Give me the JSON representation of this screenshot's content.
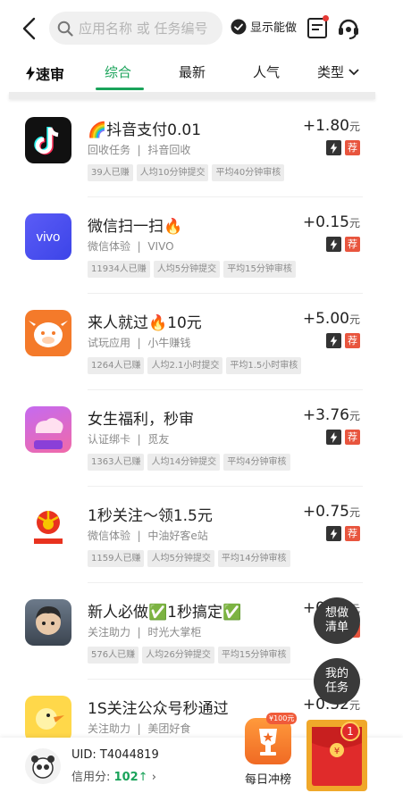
{
  "header": {
    "search_placeholder": "应用名称 或 任务编号",
    "show_done_label": "显示能做"
  },
  "tabs": {
    "brand": "速审",
    "items": [
      "综合",
      "最新",
      "人气",
      "类型"
    ],
    "active": "综合"
  },
  "price_unit": "元",
  "tasks": [
    {
      "title": "🌈抖音支付0.01",
      "category": "回收任务",
      "app": "抖音回收",
      "tags": [
        "39人已赚",
        "人均10分钟提交",
        "平均40分钟审核"
      ],
      "price": "+1.80",
      "icon": "douyin-icon"
    },
    {
      "title": "微信扫一扫🔥",
      "category": "微信体验",
      "app": "VIVO",
      "tags": [
        "11934人已赚",
        "人均5分钟提交",
        "平均15分钟审核"
      ],
      "price": "+0.15",
      "icon": "vivo-icon"
    },
    {
      "title": "来人就过🔥10元",
      "category": "试玩应用",
      "app": "小牛赚钱",
      "tags": [
        "1264人已赚",
        "人均2.1小时提交",
        "平均1.5小时审核"
      ],
      "price": "+5.00",
      "icon": "cow-icon"
    },
    {
      "title": "女生福利，秒审",
      "category": "认证绑卡",
      "app": "觅友",
      "tags": [
        "1363人已赚",
        "人均14分钟提交",
        "平均4分钟审核"
      ],
      "price": "+3.76",
      "icon": "miyou-icon"
    },
    {
      "title": "1秒关注～领1.5元",
      "category": "微信体验",
      "app": "中油好客e站",
      "tags": [
        "1159人已赚",
        "人均5分钟提交",
        "平均14分钟审核"
      ],
      "price": "+0.75",
      "icon": "petrochina-icon"
    },
    {
      "title": "新人必做✅1秒搞定✅",
      "category": "关注助力",
      "app": "时光大掌柜",
      "tags": [
        "576人已赚",
        "人均26分钟提交",
        "平均15分钟审核"
      ],
      "price": "+0.60",
      "icon": "avatar-icon"
    },
    {
      "title": "1S关注公众号秒通过",
      "category": "关注助力",
      "app": "美团好食",
      "tags": [],
      "price": "+0.52",
      "icon": "duck-icon"
    }
  ],
  "badges": {
    "fast": "lightning-icon",
    "recommend": "荐"
  },
  "float": {
    "want": "想做清单",
    "mine": "我的任务"
  },
  "bottom": {
    "uid_label": "UID:",
    "uid_value": "T4044819",
    "credit_label": "信用分:",
    "credit_value": "102",
    "daily_label": "每日冲榜",
    "daily_badge": "¥100元",
    "redpacket_count": "1"
  },
  "colors": {
    "accent": "#1aa35a",
    "recommend": "#e8553e"
  }
}
